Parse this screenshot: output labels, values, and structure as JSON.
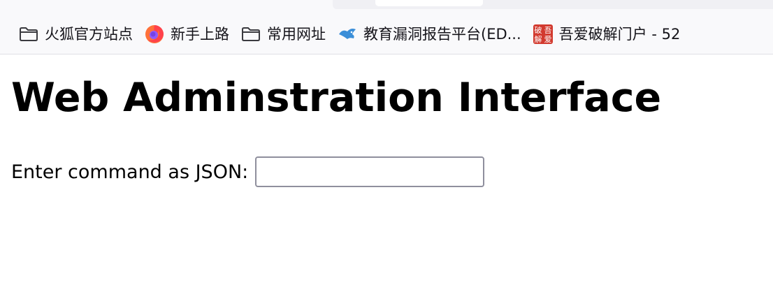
{
  "bookmarks": [
    {
      "label": "火狐官方站点",
      "icon": "folder-icon"
    },
    {
      "label": "新手上路",
      "icon": "firefox-logo-icon"
    },
    {
      "label": "常用网址",
      "icon": "folder-icon"
    },
    {
      "label": "教育漏洞报告平台(ED...",
      "icon": "edusrc-bird-icon"
    },
    {
      "label": "吾爱破解门户 - 52",
      "icon": "52pojie-seal-icon"
    }
  ],
  "page": {
    "title": "Web Adminstration Interface",
    "form": {
      "label": "Enter command as JSON:",
      "input_value": "",
      "input_placeholder": ""
    }
  },
  "seal_text": [
    "破",
    "吾",
    "解",
    "爱"
  ],
  "colors": {
    "toolbar_bg": "#f9f9fb",
    "input_border": "#8f8f9d",
    "seal_red": "#d23a2f",
    "firefox_orange": "#ff7139",
    "bird_blue": "#3b8ed8"
  }
}
